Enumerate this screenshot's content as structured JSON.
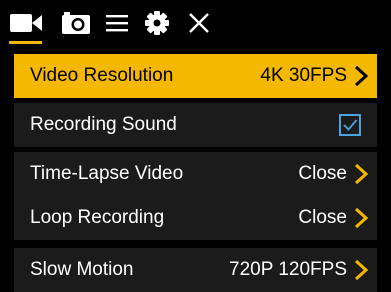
{
  "toolbar": {
    "icons": [
      {
        "name": "video-icon",
        "active": true
      },
      {
        "name": "camera-icon",
        "active": false
      },
      {
        "name": "menu-icon",
        "active": false
      },
      {
        "name": "gear-icon",
        "active": false
      },
      {
        "name": "close-icon",
        "active": false
      }
    ]
  },
  "colors": {
    "accent": "#f5b800",
    "row_background": "#1b1b1b",
    "background": "#000000",
    "text": "#ffffff",
    "checkbox": "#4aa3df"
  },
  "menu": {
    "items": [
      {
        "label": "Video Resolution",
        "value": "4K 30FPS",
        "control": "chevron",
        "selected": true
      },
      {
        "label": "Recording Sound",
        "value": "",
        "control": "checkbox",
        "checked": true
      },
      {
        "label": "Time-Lapse Video",
        "value": "Close",
        "control": "chevron"
      },
      {
        "label": "Loop Recording",
        "value": "Close",
        "control": "chevron"
      },
      {
        "label": "Slow Motion",
        "value": "720P 120FPS",
        "control": "chevron"
      }
    ]
  }
}
